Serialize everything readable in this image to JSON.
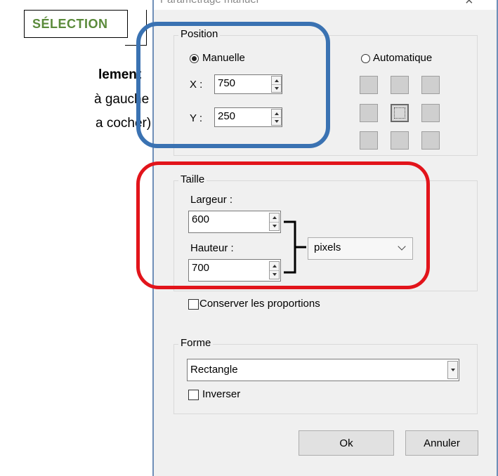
{
  "document": {
    "selection_label": "SÉLECTION",
    "line1": "lement",
    "line2": "à gauche",
    "line3": "a cocher)"
  },
  "dialog": {
    "title": "Paramétrage manuel",
    "close_glyph": "×",
    "position": {
      "group_label": "Position",
      "manual_label": "Manuelle",
      "auto_label": "Automatique",
      "manual_selected": true,
      "x_label": "X :",
      "x_value": "750",
      "y_label": "Y :",
      "y_value": "250"
    },
    "size": {
      "group_label": "Taille",
      "width_label": "Largeur :",
      "width_value": "600",
      "height_label": "Hauteur :",
      "height_value": "700",
      "unit_value": "pixels",
      "keep_ratio_label": "Conserver les proportions"
    },
    "shape": {
      "group_label": "Forme",
      "shape_value": "Rectangle",
      "invert_label": "Inverser"
    },
    "buttons": {
      "ok": "Ok",
      "cancel": "Annuler"
    }
  },
  "colors": {
    "highlight_blue": "#3a72b2",
    "highlight_red": "#e2141b",
    "selection_label_green": "#5a8a3a"
  },
  "icons": [
    "close-icon",
    "radio-icon",
    "spin-up-icon",
    "spin-down-icon",
    "chevron-down-icon",
    "bracket-icon",
    "checkbox-icon"
  ]
}
